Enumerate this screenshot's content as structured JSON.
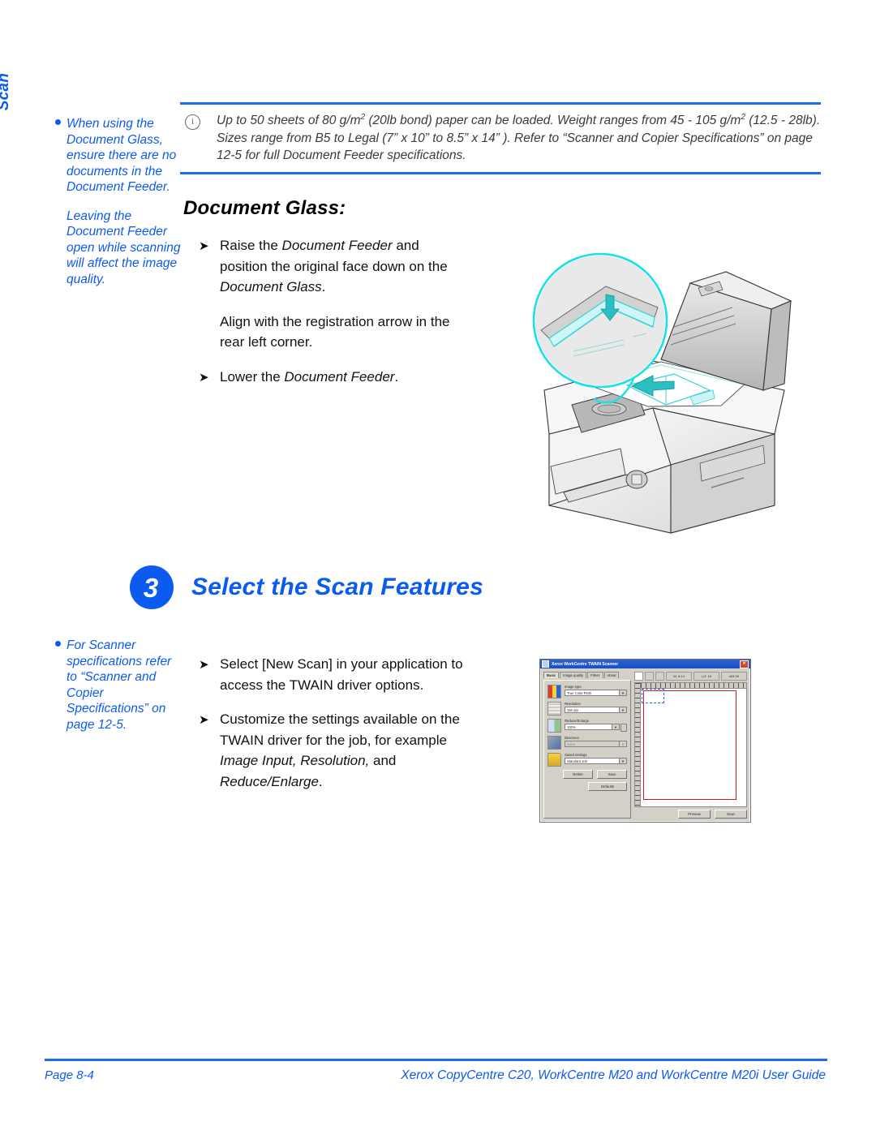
{
  "side_tab": {
    "label": "Scan"
  },
  "margin_notes": [
    {
      "id": "note-top",
      "paragraphs": [
        "When using the Document Glass, ensure there are no documents in the Document Feeder.",
        "Leaving the Document Feeder open while scanning will affect the image quality."
      ]
    },
    {
      "id": "note-bottom",
      "paragraphs": [
        "For Scanner specifications refer to “Scanner and Copier Specifications” on page 12-5."
      ]
    }
  ],
  "note_box": {
    "icon": "info-icon",
    "line1_a": "Up to 50 sheets of 80 g/m",
    "line1_sup": "2",
    "line1_b": " (20lb bond) paper can be loaded. Weight ranges from 45 - 105 g/m",
    "line1_sup2": "2",
    "line2": "(12.5 - 28lb). Sizes range from B5 to Legal (7” x 10” to 8.5” x 14” ). Refer to “Scanner and Copier",
    "line3": "Specifications” on page 12-5 for full Document Feeder specifications."
  },
  "document_glass": {
    "heading": "Document Glass:",
    "items": [
      {
        "type": "bullet",
        "marker": "➤",
        "text_parts": [
          "Raise the ",
          "Document Feeder",
          " and position the original face down on the ",
          "Document Glass",
          "."
        ]
      },
      {
        "type": "continuation",
        "text": "Align with the registration arrow in the rear left corner."
      },
      {
        "type": "bullet",
        "marker": "➤",
        "text_parts": [
          "Lower the ",
          "Document Feeder",
          "."
        ]
      }
    ]
  },
  "step": {
    "number": "3",
    "title": "Select the Scan Features",
    "accent_color": "#0b5bef"
  },
  "scan_features": {
    "items": [
      {
        "marker": "➤",
        "text": "Select [New Scan] in your application to access the TWAIN driver options."
      },
      {
        "marker": "➤",
        "lead": "Customize the settings available on the TWAIN driver for the job, for example ",
        "em1": "Image Input, Resolution,",
        "mid": " and ",
        "em2": "Reduce/Enlarge",
        "tail": "."
      }
    ]
  },
  "illustration": {
    "name": "copier-document-glass-illustration",
    "callout_color": "#17e0e8",
    "arrow_color": "#1fb8b8",
    "description": "Copier with raised Document Feeder and magnified registration-arrow corner"
  },
  "twain_dialog": {
    "title": "Xerox WorkCentre TWAIN Scanner",
    "close_label": "✕",
    "tabs": [
      "Basic",
      "Image quality",
      "Filters",
      "About"
    ],
    "active_tab": "Basic",
    "fields": [
      {
        "label": "Image type",
        "value": "True Color RGB",
        "icon": "color-swatch-icon",
        "disabled": false
      },
      {
        "label": "Resolution",
        "value": "150 dpi",
        "icon": "resolution-grid-icon",
        "disabled": false
      },
      {
        "label": "Reduce/Enlarge",
        "value": "100%",
        "icon": "reduce-enlarge-icon",
        "disabled": false,
        "spinner": true
      },
      {
        "label": "Descreen",
        "value": "None",
        "icon": "descreen-icon",
        "disabled": true
      },
      {
        "label": "Saved settings",
        "value": "Standard Job",
        "icon": "folder-icon",
        "disabled": false
      }
    ],
    "buttons": {
      "delete": "Delete",
      "save": "Save",
      "defaults": "Defaults",
      "preview": "Preview",
      "scan": "Scan"
    },
    "readouts": [
      "W: 8.14",
      "L/Z: 19",
      "453 0K"
    ]
  },
  "footer": {
    "page": "Page 8-4",
    "guide": "Xerox CopyCentre C20, WorkCentre M20 and WorkCentre M20i User Guide"
  }
}
